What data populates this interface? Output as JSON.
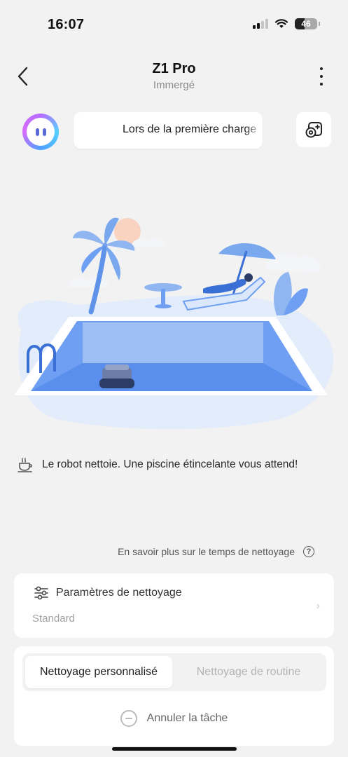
{
  "status_bar": {
    "time": "16:07",
    "battery": "46"
  },
  "header": {
    "title": "Z1 Pro",
    "subtitle": "Immergé"
  },
  "assistant": {
    "message": "Lors de la première charge"
  },
  "status_message": "Le robot nettoie. Une piscine étincelante vous attend!",
  "learn_more": "En savoir plus sur le temps de nettoyage",
  "cleaning_params": {
    "label": "Paramètres de nettoyage",
    "value": "Standard"
  },
  "modes": {
    "items": [
      {
        "label": "Nettoyage personnalisé",
        "active": true
      },
      {
        "label": "Nettoyage de routine",
        "active": false
      }
    ]
  },
  "cancel_label": "Annuler la tâche",
  "colors": {
    "background": "#f2f2f3",
    "pool": "#6f9ff2",
    "accent_light": "#dbe8fb"
  },
  "icons": [
    "back-icon",
    "more-icon",
    "assistant-avatar-icon",
    "remote-control-icon",
    "coffee-cup-icon",
    "help-icon",
    "sliders-icon",
    "chevron-right-icon",
    "cancel-icon"
  ]
}
